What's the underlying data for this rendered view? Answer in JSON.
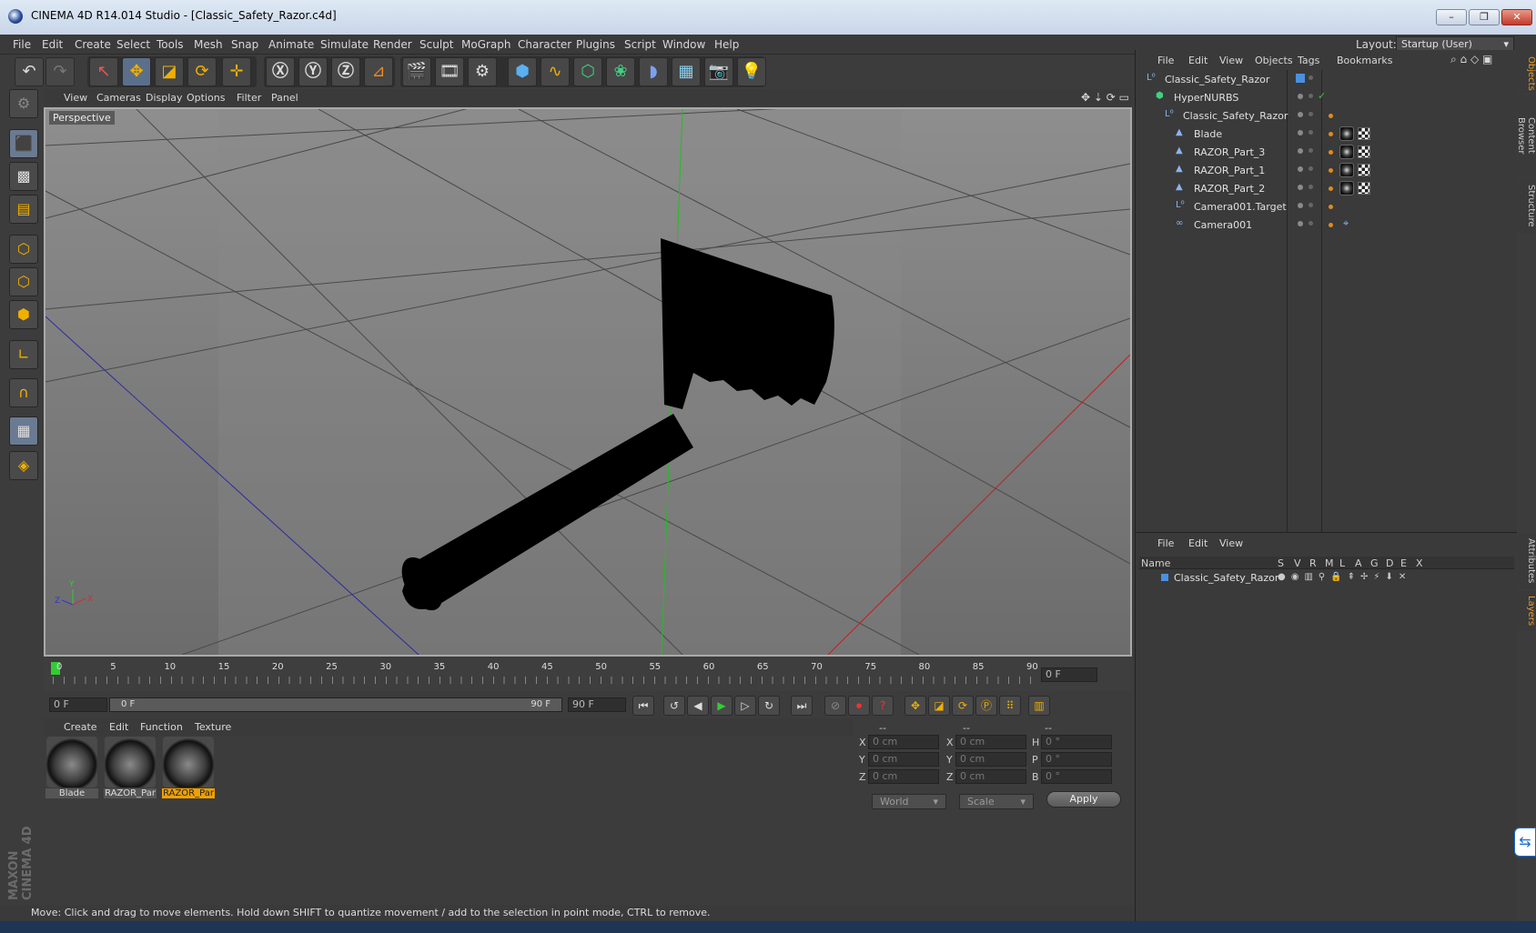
{
  "window": {
    "title": "CINEMA 4D R14.014 Studio - [Classic_Safety_Razor.c4d]",
    "min": "–",
    "max": "❐",
    "close": "✕"
  },
  "menubar": {
    "items": [
      "File",
      "Edit",
      "Create",
      "Select",
      "Tools",
      "Mesh",
      "Snap",
      "Animate",
      "Simulate",
      "Render",
      "Sculpt",
      "MoGraph",
      "Character",
      "Plugins",
      "Script",
      "Window",
      "Help"
    ],
    "layout_label": "Layout:",
    "layout_value": "Startup (User)"
  },
  "viewport": {
    "menu": [
      "View",
      "Cameras",
      "Display",
      "Options",
      "Filter",
      "Panel"
    ],
    "label": "Perspective",
    "axis_y": "Y",
    "axis_z": "Z",
    "axis_x": "X"
  },
  "timeline": {
    "ticks": [
      "0",
      "5",
      "10",
      "15",
      "20",
      "25",
      "30",
      "35",
      "40",
      "45",
      "50",
      "55",
      "60",
      "65",
      "70",
      "75",
      "80",
      "85",
      "90"
    ],
    "current_frame": "0 F",
    "start_field": "0 F",
    "range_start": "0 F",
    "range_end": "90 F",
    "end_field": "90 F"
  },
  "materials": {
    "menu": [
      "Create",
      "Edit",
      "Function",
      "Texture"
    ],
    "items": [
      {
        "name": "Blade"
      },
      {
        "name": "RAZOR_Par"
      },
      {
        "name": "RAZOR_Par"
      }
    ]
  },
  "coords": {
    "headers": [
      "--",
      "--",
      "--"
    ],
    "rows": [
      {
        "a": "X",
        "av": "0 cm",
        "b": "X",
        "bv": "0 cm",
        "c": "H",
        "cv": "0 °"
      },
      {
        "a": "Y",
        "av": "0 cm",
        "b": "Y",
        "bv": "0 cm",
        "c": "P",
        "cv": "0 °"
      },
      {
        "a": "Z",
        "av": "0 cm",
        "b": "Z",
        "bv": "0 cm",
        "c": "B",
        "cv": "0 °"
      }
    ],
    "world": "World",
    "scale": "Scale",
    "apply": "Apply"
  },
  "status": "Move: Click and drag to move elements. Hold down SHIFT to quantize movement / add to the selection in point mode, CTRL to remove.",
  "objects": {
    "menu": [
      "File",
      "Edit",
      "View",
      "Objects",
      "Tags",
      "Bookmarks"
    ],
    "tree": [
      {
        "name": "Classic_Safety_Razor"
      },
      {
        "name": "HyperNURBS"
      },
      {
        "name": "Classic_Safety_Razor"
      },
      {
        "name": "Blade"
      },
      {
        "name": "RAZOR_Part_3"
      },
      {
        "name": "RAZOR_Part_1"
      },
      {
        "name": "RAZOR_Part_2"
      },
      {
        "name": "Camera001.Target"
      },
      {
        "name": "Camera001"
      }
    ]
  },
  "layers": {
    "menu": [
      "File",
      "Edit",
      "View"
    ],
    "columns": [
      "Name",
      "S",
      "V",
      "R",
      "M",
      "L",
      "A",
      "G",
      "D",
      "E",
      "X"
    ],
    "row": "Classic_Safety_Razor"
  },
  "sidetabs": [
    "Objects",
    "Content Browser",
    "Structure",
    "Attributes",
    "Layers"
  ],
  "brand": "MAXON CINEMA 4D"
}
